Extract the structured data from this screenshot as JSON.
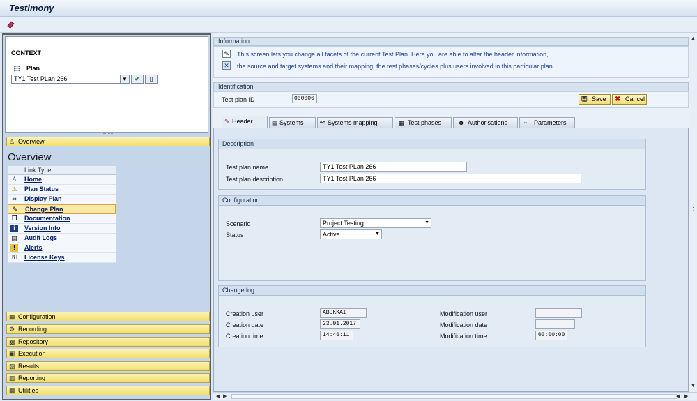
{
  "app": {
    "title": "Testimony"
  },
  "colors": {
    "nav_button": "#f2de6a",
    "info_text": "#1c3d9a",
    "panel_bg": "#c6d6ea"
  },
  "context": {
    "title": "CONTEXT",
    "plan_label": "Plan",
    "plan_value": "TY1 Test PLan 266"
  },
  "nav": {
    "overview": "Overview",
    "overview_title": "Overview",
    "link_type_header": "Link Type",
    "links": [
      "Home",
      "Plan Status",
      "Display Plan",
      "Change Plan",
      "Documentation",
      "Version Info",
      "Audit Logs",
      "Alerts",
      "License Keys"
    ],
    "selected": "Change Plan",
    "bottom": [
      "Configuration",
      "Recording",
      "Repository",
      "Execution",
      "Results",
      "Reporting",
      "Utilities"
    ]
  },
  "information": {
    "header": "Information",
    "line1": "This screen lets you change all facets of the current Test Plan. Here you are able to alter the header information,",
    "line2": "the source and target systems and their mapping, the test phases/cycles plus users involved in this particular plan."
  },
  "identification": {
    "header": "Identification",
    "test_plan_id_label": "Test plan ID",
    "test_plan_id": "000006",
    "save": "Save",
    "cancel": "Cancel"
  },
  "tabs": [
    "Header",
    "Systems",
    "Systems mapping",
    "Test phases",
    "Authorisations",
    "Parameters"
  ],
  "active_tab": "Header",
  "description": {
    "header": "Description",
    "name_label": "Test plan name",
    "name_value": "TY1 Test PLan 266",
    "desc_label": "Test plan description",
    "desc_value": "TY1 Test PLan 266"
  },
  "configuration": {
    "header": "Configuration",
    "scenario_label": "Scenario",
    "scenario_value": "Project Testing",
    "status_label": "Status",
    "status_value": "Active"
  },
  "changelog": {
    "header": "Change log",
    "creation_user_label": "Creation user",
    "creation_user": "ABEKKAI",
    "creation_date_label": "Creation date",
    "creation_date": "23.01.2017",
    "creation_time_label": "Creation time",
    "creation_time": "14:46:11",
    "mod_user_label": "Modification user",
    "mod_user": "",
    "mod_date_label": "Modification date",
    "mod_date": "",
    "mod_time_label": "Modification time",
    "mod_time": "00:00:00"
  }
}
